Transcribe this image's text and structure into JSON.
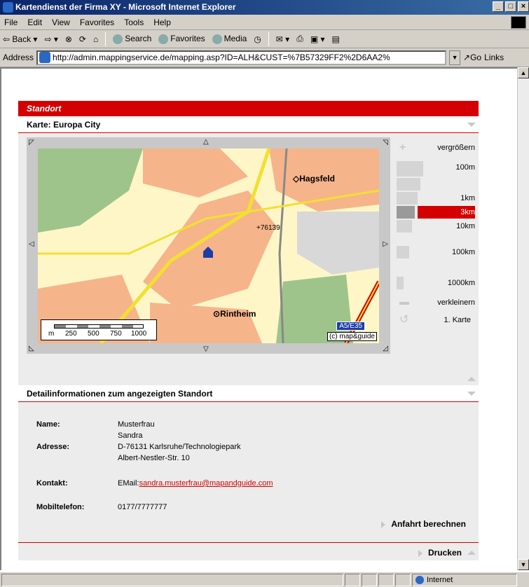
{
  "window": {
    "title": "Kartendienst der Firma XY - Microsoft Internet Explorer"
  },
  "menu": [
    "File",
    "Edit",
    "View",
    "Favorites",
    "Tools",
    "Help"
  ],
  "toolbar": {
    "back": "Back",
    "search": "Search",
    "favorites": "Favorites",
    "media": "Media"
  },
  "address": {
    "label": "Address",
    "url": "http://admin.mappingservice.de/mapping.asp?ID=ALH&CUST=%7B57329FF2%2D6AA2%",
    "go": "Go",
    "links": "Links"
  },
  "page": {
    "standort_title": "Standort",
    "karte_title": "Karte: Europa City",
    "map": {
      "places": [
        "Hagsfeld",
        "Rintheim"
      ],
      "postcode": "76139",
      "road": "A5/E35",
      "copyright": "(c) map&guide",
      "scale_unit": "m",
      "scale_ticks": [
        "250",
        "500",
        "750",
        "1000"
      ]
    },
    "zoom": {
      "in": "vergrößern",
      "levels": [
        "100m",
        "",
        "1km",
        "3km",
        "10km",
        "100km",
        "1000km"
      ],
      "active": "3km",
      "out": "verkleinern",
      "reset": "1. Karte"
    },
    "detail_title": "Detailinformationen zum angezeigten Standort",
    "name_label": "Name:",
    "name1": "Musterfrau",
    "name2": "Sandra",
    "address_label": "Adresse:",
    "address1": "D-76131 Karlsruhe/Technologiepark",
    "address2": "Albert-Nestler-Str. 10",
    "contact_label": "Kontakt:",
    "email_prefix": "EMail:",
    "email": "sandra.musterfrau@mapandguide.com",
    "mobile_label": "Mobiltelefon:",
    "mobile": "0177/7777777",
    "route_btn": "Anfahrt berechnen",
    "print_btn": "Drucken"
  },
  "status": {
    "zone": "Internet"
  }
}
